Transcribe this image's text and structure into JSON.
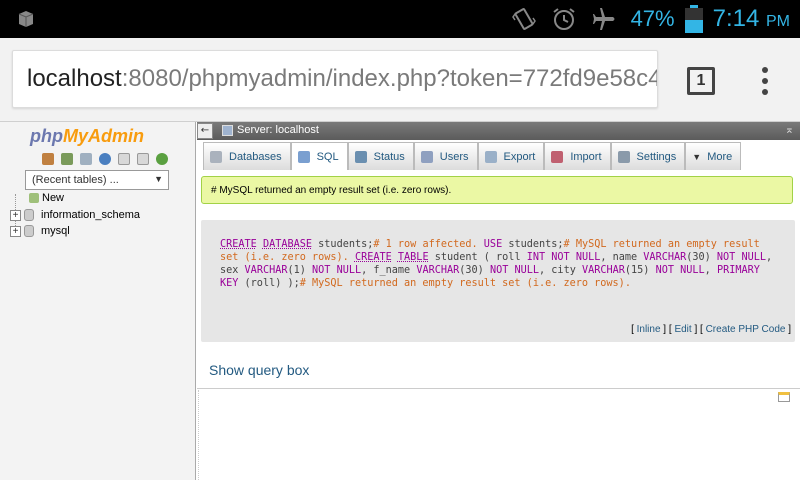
{
  "status_bar": {
    "battery_percent": "47%",
    "time": "7:14",
    "time_suffix": "PM"
  },
  "browser": {
    "url_host": "localhost",
    "url_path": ":8080/phpmyadmin/index.php?token=772fd9e58c4",
    "tab_count": "1"
  },
  "nav": {
    "logo_php": "php",
    "logo_my": "My",
    "logo_admin": "Admin",
    "recent_tables": "(Recent tables) ...",
    "tree": [
      "New",
      "information_schema",
      "mysql"
    ]
  },
  "server": {
    "label": "Server: localhost"
  },
  "tabs": [
    "Databases",
    "SQL",
    "Status",
    "Users",
    "Export",
    "Import",
    "Settings",
    "More"
  ],
  "notice": "# MySQL returned an empty result set (i.e. zero rows).",
  "sql_links": {
    "inline": "Inline",
    "edit": "Edit",
    "create_php": "Create PHP Code"
  },
  "show_query_box": "Show query box",
  "colors": {
    "accent": "#33b5e5",
    "link": "#235a81",
    "success_bg": "#ebf8a4",
    "keyword": "#990099",
    "comment": "#d2691e"
  }
}
